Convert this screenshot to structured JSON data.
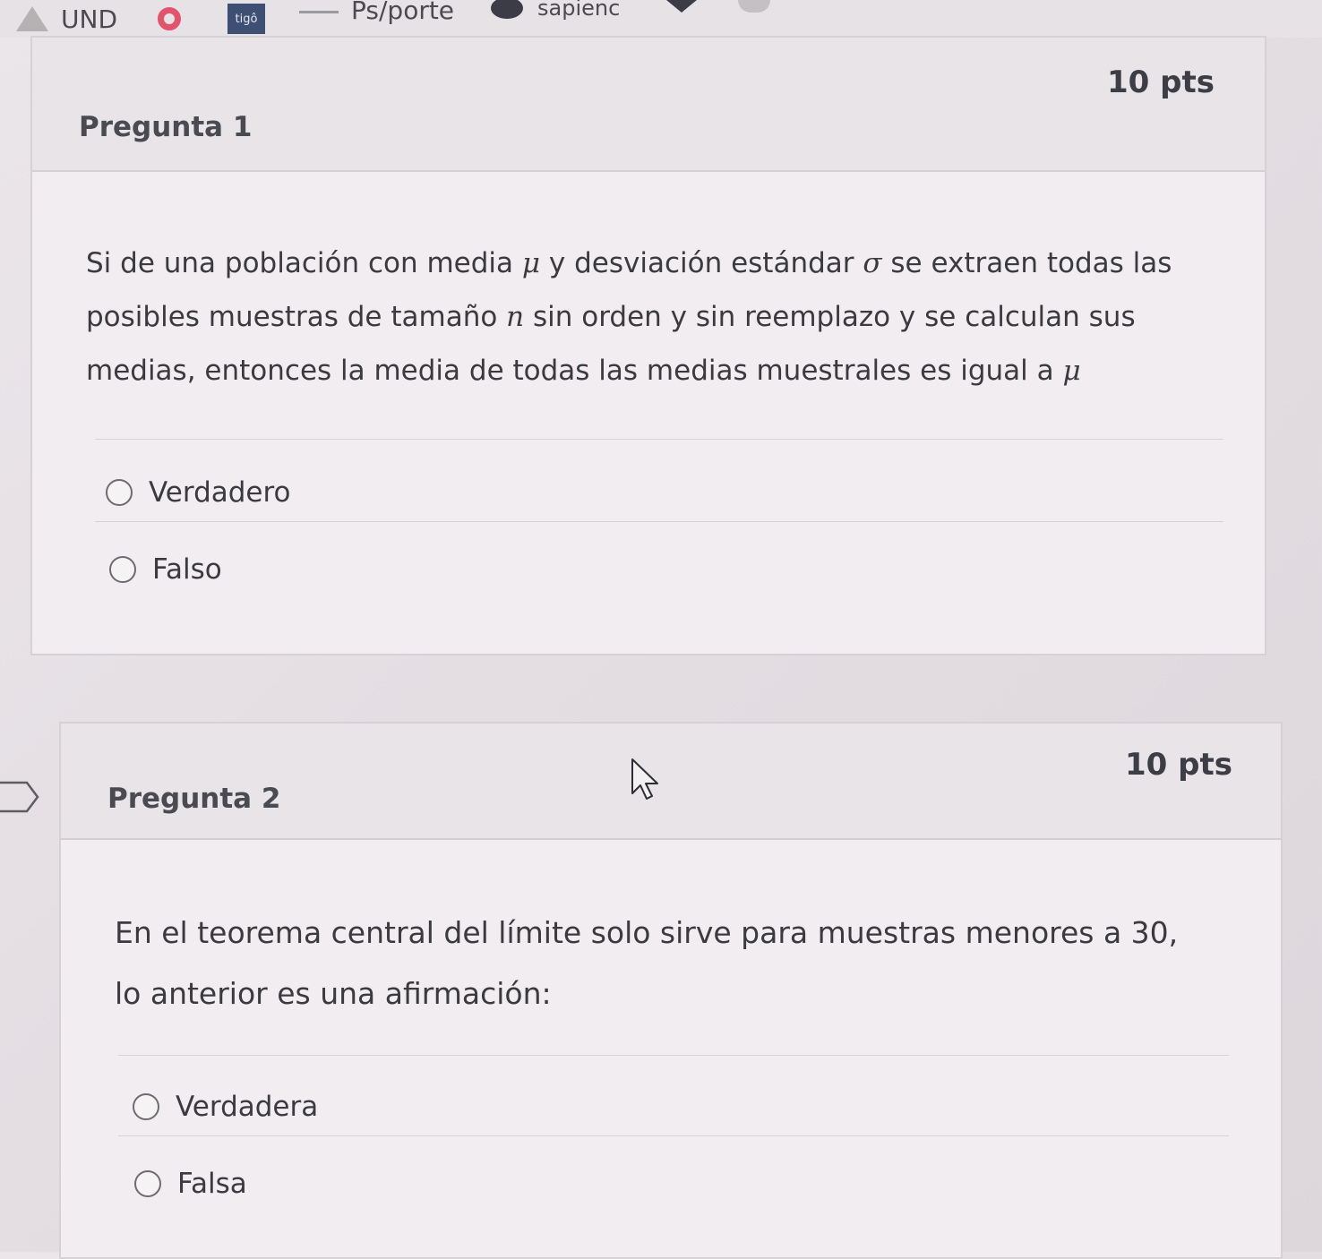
{
  "bookmarks": {
    "und_label": "UND",
    "tigo_label": "tigô",
    "psporte_label": "Ps/porte",
    "sapienc_label": "sapienc"
  },
  "questions": [
    {
      "title": "Pregunta 1",
      "points": "10 pts",
      "text_lines": [
        "Si de una población con media ",
        " y desviación estándar ",
        " se extraen todas las",
        "posibles muestras de tamaño ",
        " sin orden y sin reemplazo y se calculan sus",
        "medias, entonces la media de todas las medias muestrales es igual a "
      ],
      "symbols": {
        "mu": "μ",
        "sigma": "σ",
        "n": "n"
      },
      "options": [
        {
          "label": "Verdadero",
          "selected": false
        },
        {
          "label": "Falso",
          "selected": false
        }
      ]
    },
    {
      "title": "Pregunta 2",
      "points": "10 pts",
      "text_lines": [
        "En el teorema central del límite solo sirve para muestras menores a 30,",
        "lo anterior es una afirmación:"
      ],
      "options": [
        {
          "label": "Verdadera",
          "selected": false
        },
        {
          "label": "Falsa",
          "selected": false
        }
      ]
    }
  ]
}
